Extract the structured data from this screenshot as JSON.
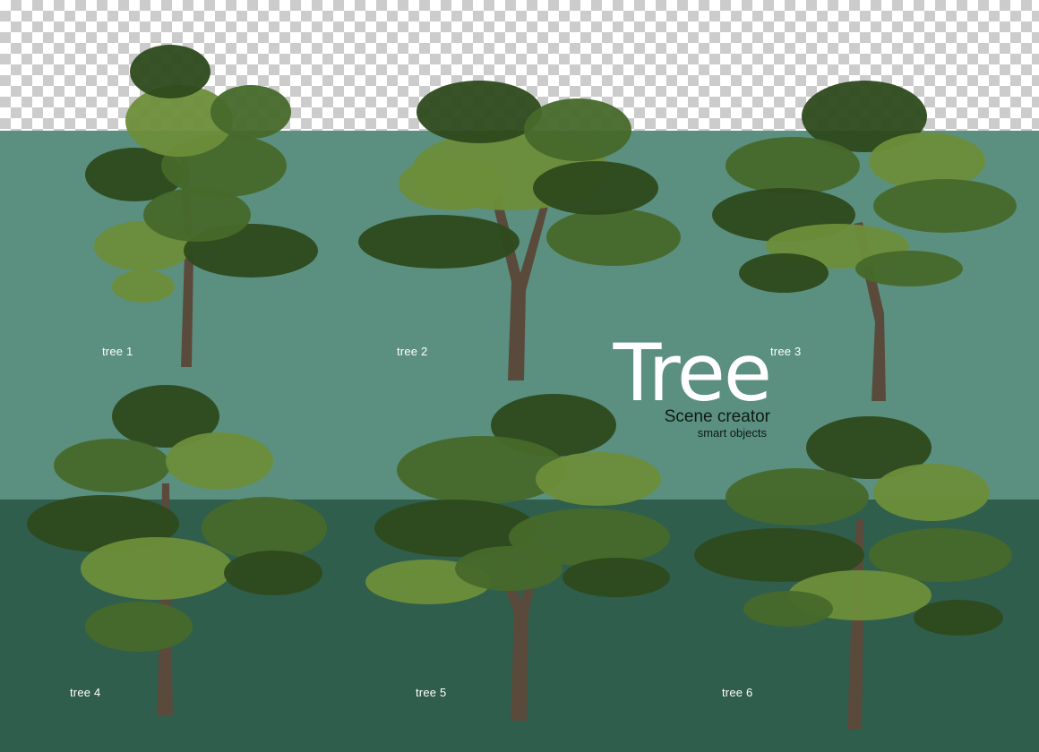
{
  "colors": {
    "band_mid": "#5b9080",
    "band_low": "#2f5e4d",
    "foliage_dark": "#2e4a1c",
    "foliage_mid": "#47692a",
    "foliage_light": "#6d8e3a",
    "trunk": "#5a4a3c"
  },
  "trees": [
    {
      "label": "tree 1"
    },
    {
      "label": "tree 2"
    },
    {
      "label": "tree 3"
    },
    {
      "label": "tree 4"
    },
    {
      "label": "tree 5"
    },
    {
      "label": "tree 6"
    }
  ],
  "branding": {
    "title": "Tree",
    "subtitle": "Scene creator",
    "tagline": "smart objects"
  }
}
